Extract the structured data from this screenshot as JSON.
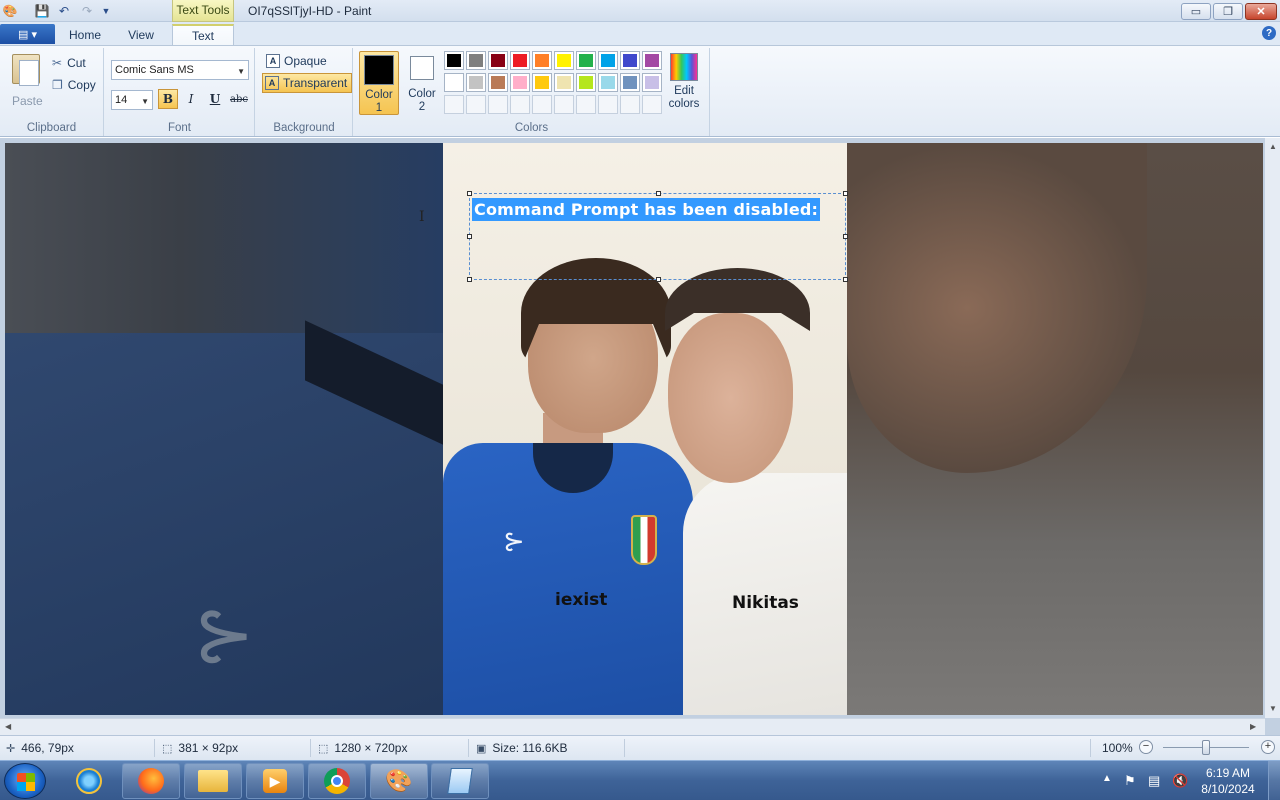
{
  "window": {
    "title": "OI7qSSlTjyI-HD - Paint",
    "contextual_tab": "Text Tools",
    "min_symbol": "▭",
    "max_symbol": "❐",
    "close_symbol": "✕"
  },
  "ribbon_tabs": [
    "Home",
    "View",
    "Text"
  ],
  "clipboard": {
    "paste": "Paste",
    "cut": "Cut",
    "copy": "Copy",
    "label": "Clipboard"
  },
  "font": {
    "family": "Comic Sans MS",
    "size": "14",
    "bold": "B",
    "italic": "I",
    "underline": "U",
    "strike": "abc",
    "label": "Font"
  },
  "background": {
    "opaque": "Opaque",
    "transparent": "Transparent",
    "label": "Background",
    "selected": "Transparent"
  },
  "colors": {
    "color1_label_a": "Color",
    "color1_label_b": "1",
    "color2_label_a": "Color",
    "color2_label_b": "2",
    "color1": "#000000",
    "color2": "#ffffff",
    "label": "Colors",
    "edit_a": "Edit",
    "edit_b": "colors",
    "palette_row1": [
      "#000000",
      "#7f7f7f",
      "#880015",
      "#ed1c24",
      "#ff7f27",
      "#fff200",
      "#22b14c",
      "#00a2e8",
      "#3f48cc",
      "#a349a4"
    ],
    "palette_row2": [
      "#ffffff",
      "#c3c3c3",
      "#b97a57",
      "#ffaec9",
      "#ffc90e",
      "#efe4b0",
      "#b5e61d",
      "#99d9ea",
      "#7092be",
      "#c8bfe7"
    ],
    "palette_row3": [
      "#ffffff",
      "#ffffff",
      "#ffffff",
      "#ffffff",
      "#ffffff",
      "#ffffff",
      "#ffffff",
      "#ffffff",
      "#ffffff",
      "#ffffff"
    ]
  },
  "canvas": {
    "selected_text": "Command Prompt has been disabled:",
    "label_left": "iexist",
    "label_right": "Nikitas",
    "brand_mark": "⊱"
  },
  "status": {
    "cursor_pos": "466, 79px",
    "selection_size": "381 × 92px",
    "image_size": "1280 × 720px",
    "file_size": "Size: 116.6KB",
    "zoom": "100%",
    "zoom_fraction": 0.5
  },
  "taskbar": {
    "apps": [
      "Internet Explorer",
      "Firefox",
      "File Explorer",
      "Media Player",
      "Chrome",
      "Paint",
      "Notepad"
    ],
    "time": "6:19 AM",
    "date": "8/10/2024"
  }
}
